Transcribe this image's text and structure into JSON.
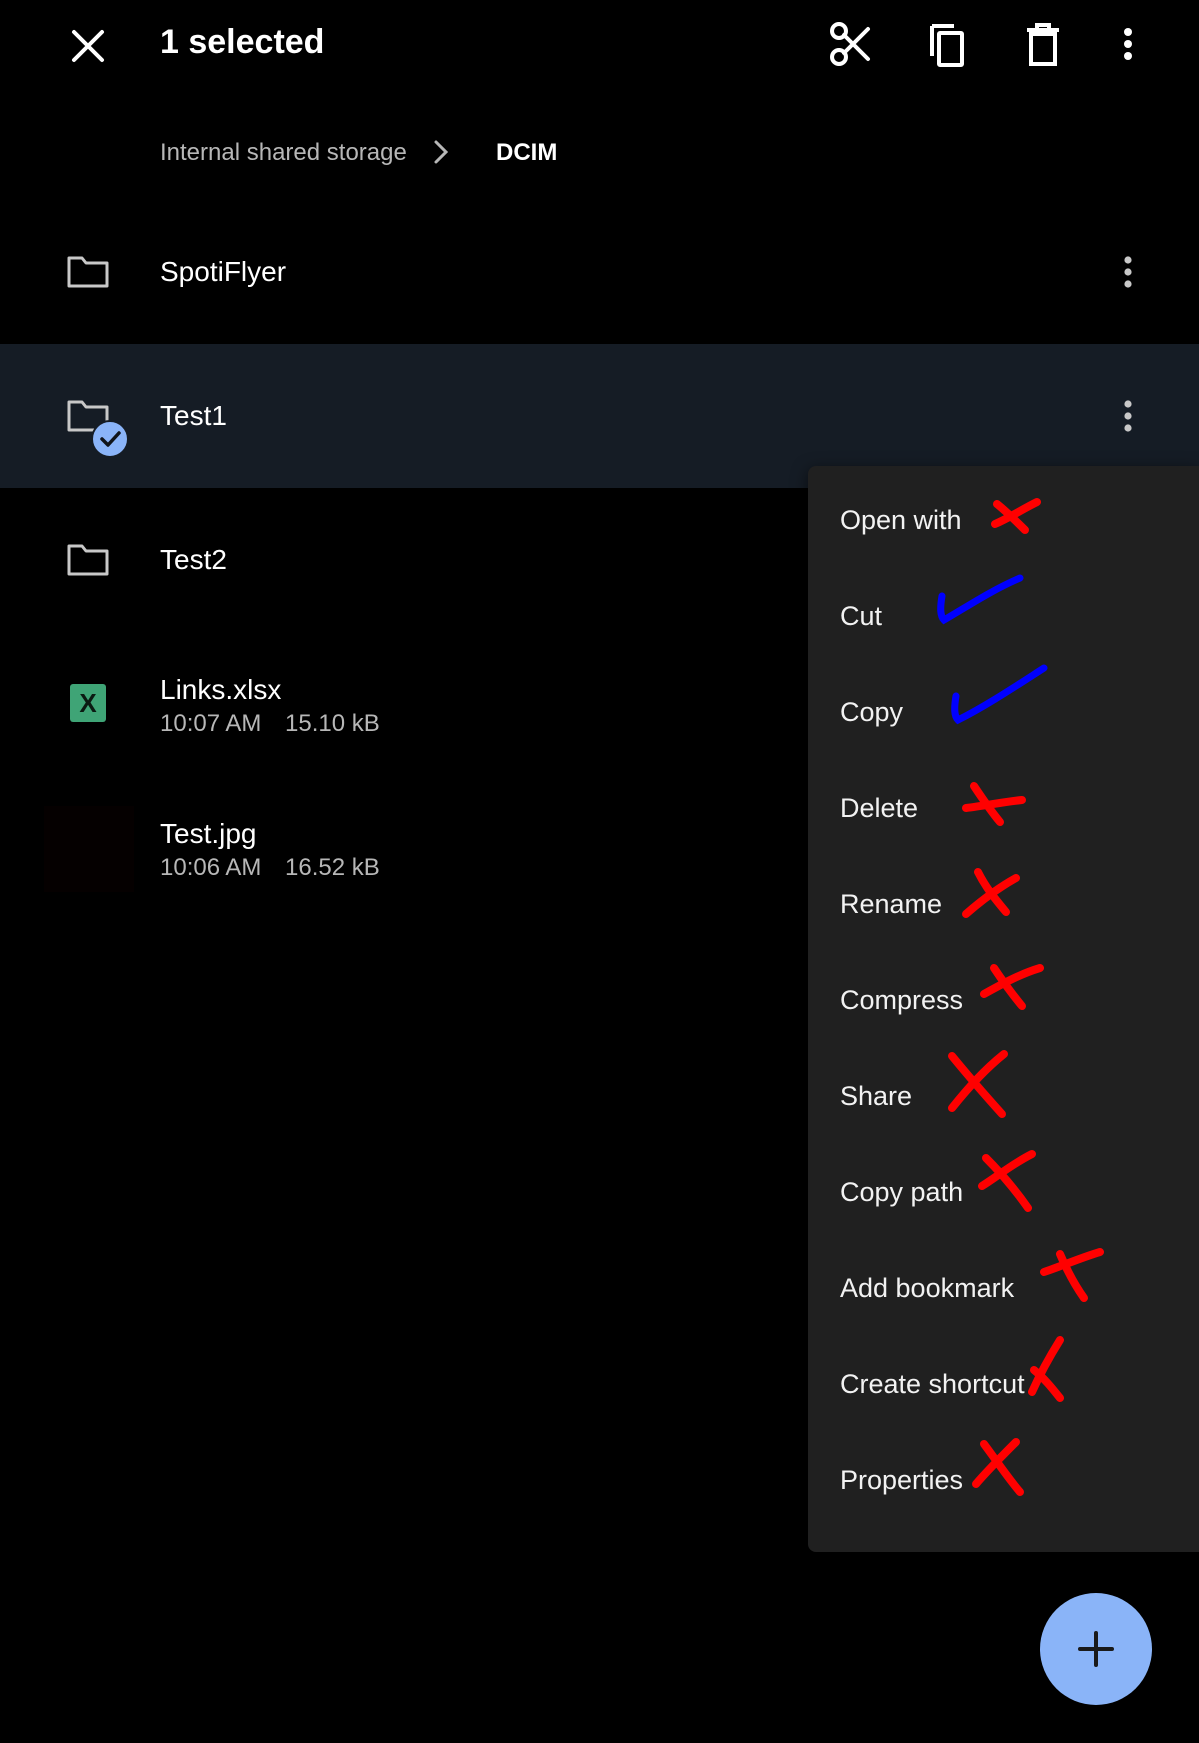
{
  "topbar": {
    "close_icon": "close-icon",
    "title": "1 selected",
    "actions": [
      "cut-icon",
      "copy-icon",
      "delete-icon",
      "more-vert-icon"
    ]
  },
  "breadcrumb": {
    "items": [
      "Internal shared storage",
      "DCIM"
    ]
  },
  "files": [
    {
      "name": "SpotiFlyer",
      "type": "folder"
    },
    {
      "name": "Test1",
      "type": "folder",
      "selected": true
    },
    {
      "name": "Test2",
      "type": "folder"
    },
    {
      "name": "Links.xlsx",
      "type": "xlsx",
      "badge": "X",
      "time": "10:07 AM",
      "size": "15.10 kB"
    },
    {
      "name": "Test.jpg",
      "type": "image",
      "time": "10:06 AM",
      "size": "16.52 kB"
    }
  ],
  "menu": {
    "items": [
      {
        "label": "Open with",
        "mark": "cross"
      },
      {
        "label": "Cut",
        "mark": "check"
      },
      {
        "label": "Copy",
        "mark": "check"
      },
      {
        "label": "Delete",
        "mark": "cross"
      },
      {
        "label": "Rename",
        "mark": "cross"
      },
      {
        "label": "Compress",
        "mark": "cross"
      },
      {
        "label": "Share",
        "mark": "cross"
      },
      {
        "label": "Copy path",
        "mark": "cross"
      },
      {
        "label": "Add bookmark",
        "mark": "cross"
      },
      {
        "label": "Create shortcut",
        "mark": "cross"
      },
      {
        "label": "Properties",
        "mark": "cross"
      }
    ]
  },
  "fab": {
    "icon": "plus-icon"
  },
  "colors": {
    "background": "#000000",
    "selected_row": "#151c25",
    "menu_bg": "#202020",
    "accent": "#8ab4f8",
    "check_mark": "#0000ff",
    "cross_mark": "#ff0000",
    "xlsx_green": "#3fa476"
  }
}
